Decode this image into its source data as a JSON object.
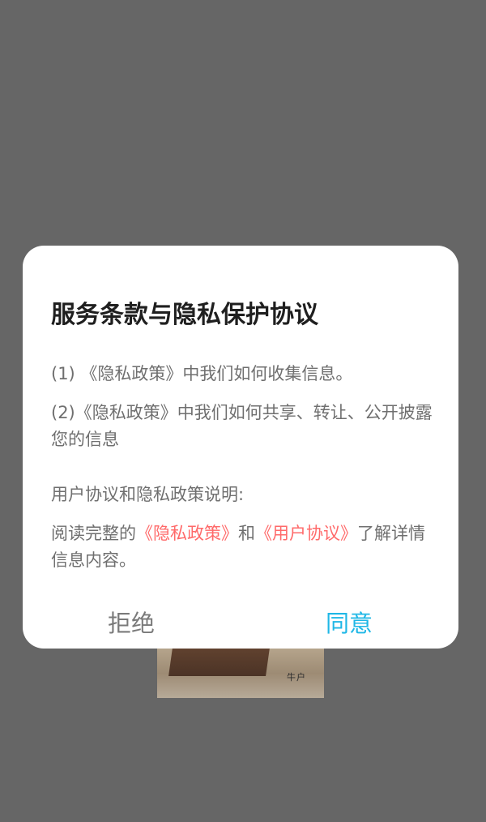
{
  "dialog": {
    "title": "服务条款与隐私保护协议",
    "items": [
      "(1) 《隐私政策》中我们如何收集信息。",
      "(2)《隐私政策》中我们如何共享、转让、公开披露您的信息"
    ],
    "section_label": "用户协议和隐私政策说明:",
    "notice": {
      "prefix": "阅读完整的",
      "link_privacy": "《隐私政策》",
      "middle": "和",
      "link_user_agreement": "《用户协议》",
      "suffix": "了解详情信息内容。"
    },
    "buttons": {
      "reject_label": "拒绝",
      "agree_label": "同意"
    }
  },
  "background": {
    "image_text": "牛户"
  },
  "colors": {
    "overlay": "#666666",
    "dialog_background": "#ffffff",
    "link": "#ff6a6a",
    "agree_button": "#1fb7e6",
    "reject_button": "#7a7a7a",
    "title_text": "#1f1f1f",
    "body_text": "#6f6f6f"
  }
}
